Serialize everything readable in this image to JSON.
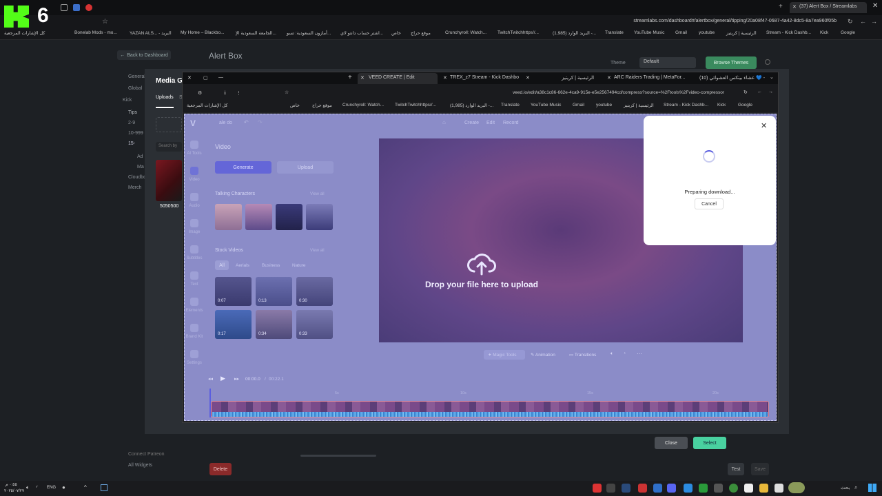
{
  "outer_browser": {
    "active_tab": "(37) Alert Box / Streamlabs",
    "url": "streamlabs.com/dashboard#/alertbox/general/tipping/20a08f47-0687-4a42-8dc5-8a7ea960f05b",
    "bookmarks": [
      "كل الإشارات المرجعية",
      "Bonelab Mods - mo...",
      "YAZAN ALS... - البريد",
      "My Home – Blackbo...",
      "الجامعة السعودية الإ...",
      "أمازون السعودية: تسو...",
      "اشتر حساب دانتو لاي...",
      "خاص",
      "موقع حراج",
      "Crunchyroll: Watch...",
      "TwitchTwitchhttps//...",
      "(1,985) البريد الوارد -...",
      "Translate",
      "YouTube Music",
      "Gmail",
      "youtube",
      "الرئيسية | كريتيز",
      "Stream - Kick Dashb...",
      "Kick",
      "Google"
    ],
    "kick_badge": "6"
  },
  "streamlabs": {
    "back_label": "Back to Dashboard",
    "page_title": "Alert Box",
    "theme_label": "Theme",
    "theme_value": "Default",
    "browse_themes": "Browse Themes",
    "nav": [
      "General",
      "Global",
      "Kick",
      "Tips",
      "2-9",
      "10-999",
      "15-",
      "Ad",
      "Ma",
      "Cloudbot",
      "Merch"
    ],
    "modal_title": "Media Ga",
    "tab_uploads": "Uploads",
    "tab_s": "S",
    "search_placeholder": "Search by",
    "media_item_label": "5050500",
    "connect_label": "Connect Patreon",
    "all_widgets": "All Widgets",
    "close_btn": "Close",
    "select_btn": "Select",
    "delete_btn": "Delete",
    "test_btn": "Test",
    "save_btn": "Save"
  },
  "inner_browser": {
    "tabs": [
      "VEED CREATE | Edit",
      "TREX_z7 Stream - Kick Dashbo",
      "الرئيسية | كريتيز",
      "ARC Raiders Trading | MetaFor...",
      "(10) عشاء بيتكس العشوائي 💙 -"
    ],
    "url": "veed.io/edit/a38c1c86-662e-4ca9-915e-e5e2567494cd/compress?source=%2Ftools%2Fvideo-compressor",
    "bookmarks": [
      "كل الإشارات المرجعية",
      "خاص",
      "موقع حراج",
      "Crunchyroll: Watch...",
      "TwitchTwitchhttps//...",
      "(1,985) البريد الوارد -...",
      "Translate",
      "YouTube Music",
      "Gmail",
      "youtube",
      "الرئيسية | كريتيز",
      "Stream - Kick Dashb...",
      "Kick",
      "Google"
    ]
  },
  "veed": {
    "project_name": "ale do",
    "top_nav": [
      "Create",
      "Edit",
      "Record"
    ],
    "sidebar": [
      "AI Tools",
      "Video",
      "Audio",
      "Image",
      "Subtitles",
      "Text",
      "Elements",
      "Brand Kit",
      "Settings"
    ],
    "panel_title": "Video",
    "generate_label": "Generate",
    "upload_label": "Upload",
    "talking_characters": "Talking Characters",
    "view_all": "View all",
    "stock_videos": "Stock Videos",
    "filters": [
      "All",
      "Aerials",
      "Business",
      "Nature"
    ],
    "durations": [
      "0:07",
      "0:13",
      "0:30",
      "0:17",
      "0:34",
      "0:33"
    ],
    "drop_text": "Drop your file here to upload",
    "bottom_tools": [
      "Magic Tools",
      "Animation",
      "Transitions"
    ],
    "time_current": "00:00.0",
    "time_sep": "/",
    "time_total": "00:22.1",
    "ruler": [
      "5s",
      "10s",
      "15s",
      "20s"
    ]
  },
  "popup": {
    "status": "Preparing download...",
    "cancel": "Cancel"
  },
  "taskbar": {
    "time": "٠:٥٥ م",
    "date": "٢٠٢٥/٠٧/٢٧",
    "lang": "ENG",
    "search": "بحث"
  }
}
